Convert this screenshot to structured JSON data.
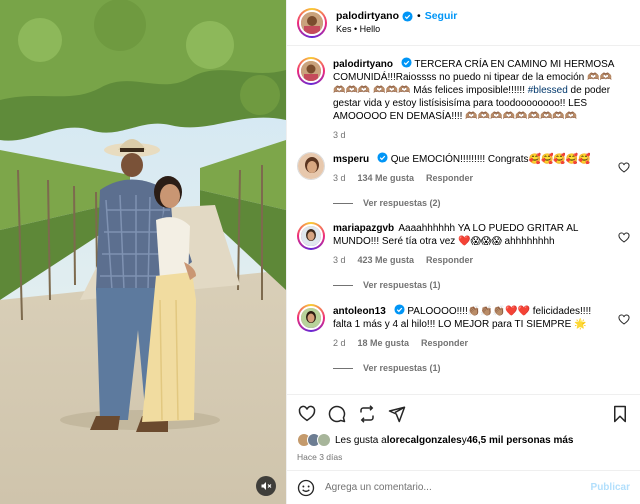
{
  "post": {
    "author": "palodirtyano",
    "follow_label": "Seguir",
    "dot": "•",
    "audio": "Kes • Hello"
  },
  "caption": {
    "username": "palodirtyano",
    "text_before_tag": "TERCERA CRÍA EN CAMINO MI HERMOSA COMUNIDÁ!!!Raiossss no puedo ni tipear de la emoción 🫶🏽🫶🏽🫶🏽🫶🏽🫶🏽 🫶🏽🫶🏽🫶🏽 Más felices imposible!!!!!! ",
    "hashtag": "#blessed",
    "text_after_tag": " de poder gestar vida y estoy listísisisíma para toodoooooooo!! LES AMOOOOO EN DEMASÍA!!!! 🫶🏽🫶🏽🫶🏽🫶🏽🫶🏽🫶🏽🫶🏽🫶🏽🫶🏽",
    "time": "3 d"
  },
  "comments": [
    {
      "username": "msperu",
      "text": "Que EMOCIÓN!!!!!!!!! Congrats🥰🥰🥰🥰🥰",
      "time": "3 d",
      "likes": "134 Me gusta",
      "reply": "Responder",
      "replies": "Ver respuestas (2)"
    },
    {
      "username": "mariapazgvb",
      "text": "Aaaahhhhhh YA LO PUEDO GRITAR AL MUNDO!!! Seré tía otra vez ❤️😱😱😱 ahhhhhhhh",
      "time": "3 d",
      "likes": "423 Me gusta",
      "reply": "Responder",
      "replies": "Ver respuestas (1)"
    },
    {
      "username": "antoleon13",
      "text": "PALOOOO!!!!👏🏽👏🏽👏🏽❤️❤️ felicidades!!!! falta 1 más y 4 al hilo!!! LO MEJOR para TI SIEMPRE 🌟",
      "time": "2 d",
      "likes": "18 Me gusta",
      "reply": "Responder",
      "replies": "Ver respuestas (1)"
    }
  ],
  "likes": {
    "prefix": "Les gusta a ",
    "user": "lorecalgonzales",
    "middle": " y ",
    "others": "46,5 mil personas más"
  },
  "date": "Hace 3 días",
  "comment_box": {
    "placeholder": "Agrega un comentario...",
    "publish_label": "Publicar"
  },
  "icons": {
    "verified": "verified-badge-icon",
    "like": "heart-icon",
    "comment": "comment-icon",
    "share": "share-icon",
    "repost": "repost-icon",
    "save": "bookmark-icon",
    "emoji": "emoji-icon",
    "mute": "muted-speaker-icon"
  },
  "colors": {
    "accent": "#0095f6",
    "verified": "#0095f6",
    "hashtag": "#00376b",
    "publish_disabled": "#b2dffc",
    "secondary_text": "#737373"
  }
}
